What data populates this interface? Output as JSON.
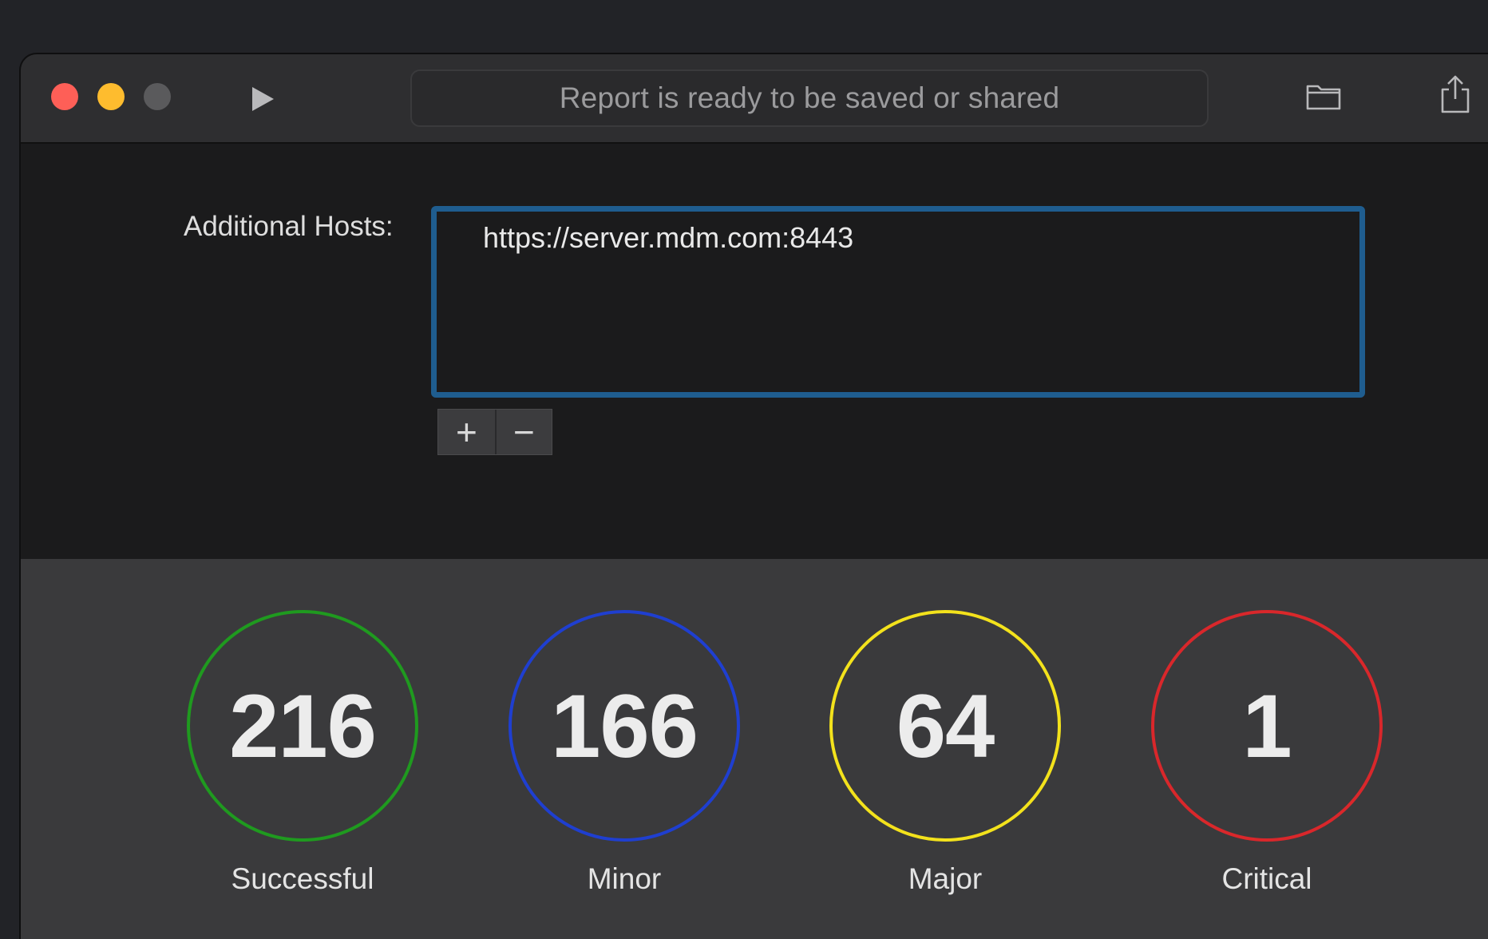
{
  "toolbar": {
    "status_text": "Report is ready to be saved or shared"
  },
  "hosts": {
    "label": "Additional Hosts:",
    "entries": [
      "https://server.mdm.com:8443"
    ],
    "add_label": "+",
    "remove_label": "−"
  },
  "summary": {
    "stats": [
      {
        "label": "Successful",
        "count": "216",
        "color": "#1f9a1f"
      },
      {
        "label": "Minor",
        "count": "166",
        "color": "#1f3fd0"
      },
      {
        "label": "Major",
        "count": "64",
        "color": "#f3e21c"
      },
      {
        "label": "Critical",
        "count": "1",
        "color": "#d9272b"
      }
    ]
  },
  "icons": [
    "play-icon",
    "folder-icon",
    "share-icon"
  ],
  "colors": {
    "close": "#fe5f57",
    "minimize": "#febc2e",
    "zoom_disabled": "#5a5a5c",
    "focus_ring": "#1f5d8f"
  }
}
